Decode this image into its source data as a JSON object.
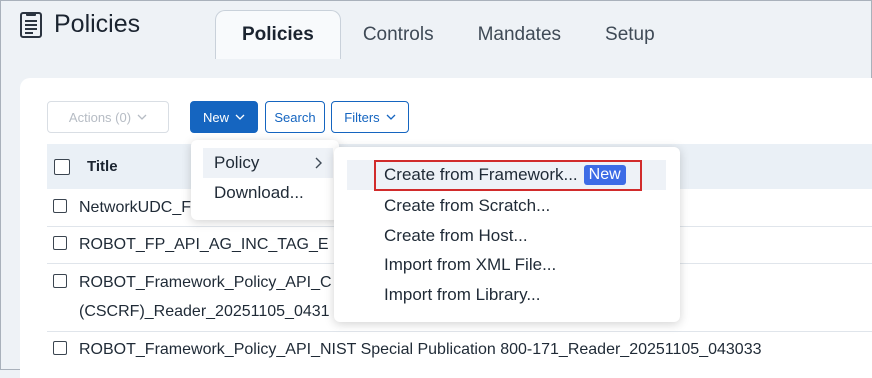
{
  "header": {
    "title": "Policies"
  },
  "tabs": [
    {
      "label": "Policies",
      "active": true
    },
    {
      "label": "Controls"
    },
    {
      "label": "Mandates"
    },
    {
      "label": "Setup"
    }
  ],
  "toolbar": {
    "actions_label": "Actions (0)",
    "new_label": "New",
    "search_label": "Search",
    "filters_label": "Filters"
  },
  "table": {
    "header": "Title",
    "rows": [
      {
        "line1": "NetworkUDC_F"
      },
      {
        "line1": "ROBOT_FP_API_AG_INC_TAG_E"
      },
      {
        "line1": "ROBOT_Framework_Policy_API_C",
        "line2": "(CSCRF)_Reader_20251105_0431"
      },
      {
        "line1": "ROBOT_Framework_Policy_API_NIST Special Publication 800-171_Reader_20251105_043033"
      }
    ]
  },
  "new_menu": {
    "items": [
      {
        "label": "Policy"
      },
      {
        "label": "Download..."
      }
    ]
  },
  "policy_submenu": {
    "items": [
      {
        "label": "Create from Framework...",
        "badge": "New"
      },
      {
        "label": "Create from Scratch..."
      },
      {
        "label": "Create from Host..."
      },
      {
        "label": "Import from XML File..."
      },
      {
        "label": "Import from Library..."
      }
    ]
  },
  "colors": {
    "primary": "#1565c0",
    "highlight_box": "#d12b2b",
    "badge": "#3d6ce6"
  }
}
